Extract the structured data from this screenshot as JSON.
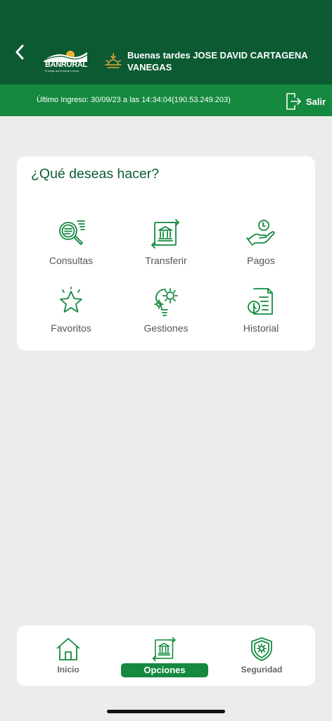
{
  "header": {
    "brand": "BANRURAL",
    "slogan": "El amigo que te ayuda a crecer",
    "greeting": "Buenas tardes JOSE DAVID CARTAGENA VANEGAS"
  },
  "infobar": {
    "last_login": "Último Ingreso: 30/09/23 a las 14:34:04(190.53.249.203)",
    "logout_label": "Salir"
  },
  "card": {
    "title": "¿Qué deseas hacer?",
    "items": [
      {
        "label": "Consultas",
        "icon": "magnifier-document-icon"
      },
      {
        "label": "Transferir",
        "icon": "bank-transfer-icon"
      },
      {
        "label": "Pagos",
        "icon": "hand-coin-icon"
      },
      {
        "label": "Favoritos",
        "icon": "star-icon"
      },
      {
        "label": "Gestiones",
        "icon": "lightbulb-gear-icon"
      },
      {
        "label": "Historial",
        "icon": "document-clock-icon"
      }
    ]
  },
  "nav": {
    "home": "Inicio",
    "options": "Opciones",
    "security": "Seguridad",
    "active": "Opciones"
  },
  "colors": {
    "header_bg": "#0b5a32",
    "accent": "#15893f",
    "icon_green": "#138a3e",
    "sun": "#e0a23a"
  }
}
